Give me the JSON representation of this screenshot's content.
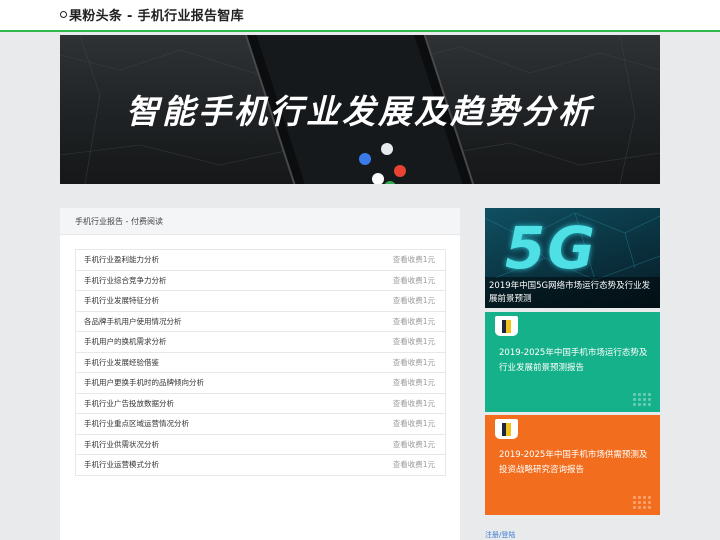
{
  "header": {
    "site_title": "果粉头条 - 手机行业报告智库"
  },
  "banner": {
    "title": "智能手机行业发展及趋势分析"
  },
  "panel": {
    "heading": "手机行业报告 - 付费阅读",
    "items": [
      {
        "title": "手机行业盈利能力分析",
        "price": "查看收费1元"
      },
      {
        "title": "手机行业综合竞争力分析",
        "price": "查看收费1元"
      },
      {
        "title": "手机行业发展特征分析",
        "price": "查看收费1元"
      },
      {
        "title": "各品牌手机用户使用情况分析",
        "price": "查看收费1元"
      },
      {
        "title": "手机用户的换机需求分析",
        "price": "查看收费1元"
      },
      {
        "title": "手机行业发展经验借鉴",
        "price": "查看收费1元"
      },
      {
        "title": "手机用户更换手机时的品牌倾向分析",
        "price": "查看收费1元"
      },
      {
        "title": "手机行业广告投放数据分析",
        "price": "查看收费1元"
      },
      {
        "title": "手机行业重点区域运营情况分析",
        "price": "查看收费1元"
      },
      {
        "title": "手机行业供需状况分析",
        "price": "查看收费1元"
      },
      {
        "title": "手机行业运营模式分析",
        "price": "查看收费1元"
      }
    ]
  },
  "sidebar": {
    "card1": {
      "image_text": "5G",
      "caption": "2019年中国5G网络市场运行态势及行业发展前景预测"
    },
    "card2": {
      "caption": "2019-2025年中国手机市场运行态势及行业发展前景预测报告"
    },
    "card3": {
      "caption": "2019-2025年中国手机市场供需预测及投资战略研究咨询报告"
    },
    "login_link": "注册/登陆"
  },
  "colors": {
    "accent_green": "#2fb74a",
    "card_teal": "#15b18a",
    "card_orange": "#f26d1d"
  }
}
